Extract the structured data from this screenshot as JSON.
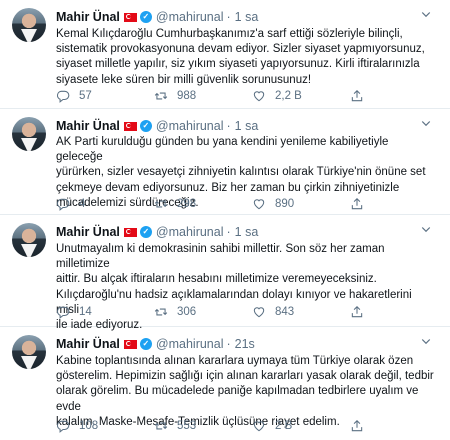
{
  "tweets": [
    {
      "name": "Mahir Ünal",
      "handle": "@mahirunal",
      "dot": "·",
      "time": "1 sa",
      "text": "Kemal Kılıçdaroğlu Cumhurbaşkanımız'a sarf ettiği  sözleriyle bilinçli,\nsistematik provokasyonuna devam ediyor. Sizler siyaset yapmıyorsunuz,\nsiyaset milletle yapılır, siz yıkım siyaseti yapıyorsunuz. Kirli iftiralarınızla\nsiyasete leke süren bir milli güvenlik sorunusunuz!",
      "replies": "57",
      "retweets": "988",
      "likes": "2,2 B"
    },
    {
      "name": "Mahir Ünal",
      "handle": "@mahirunal",
      "dot": "·",
      "time": "1 sa",
      "text": "AK Parti kurulduğu günden bu yana kendini yenileme kabiliyetiyle geleceğe\nyürürken, sizler vesayetçi zihniyetin kalıntısı olarak Türkiye'nin önüne set\nçekmeye devam ediyorsunuz. Biz her zaman bu çirkin zihniyetinizle\nmücadelemizi sürdüreceğiz.",
      "replies": "4",
      "retweets": "298",
      "likes": "890"
    },
    {
      "name": "Mahir Ünal",
      "handle": "@mahirunal",
      "dot": "·",
      "time": "1 sa",
      "text": "Unutmayalım ki demokrasinin sahibi millettir. Son söz her zaman milletimize\naittir. Bu alçak iftiraların hesabını milletimize veremeyeceksiniz.\nKılıçdaroğlu'nu hadsiz açıklamalarından dolayı kınıyor ve hakaretlerini misli\nile iade ediyoruz.",
      "replies": "14",
      "retweets": "306",
      "likes": "843"
    },
    {
      "name": "Mahir Ünal",
      "handle": "@mahirunal",
      "dot": "·",
      "time": "21s",
      "text": "Kabine toplantısında alınan kararlara uymaya tüm Türkiye olarak özen\ngösterelim. Hepimizin sağlığı için alınan kararları yasak olarak değil, tedbir\nolarak görelim. Bu mücadelede paniğe kapılmadan tedbirlere uyalım ve evde\nkalalım. Maske-Mesafe-Temizlik üçlüsüne riayet edelim.",
      "replies": "108",
      "retweets": "553",
      "likes": "2 B"
    }
  ],
  "icons": {
    "reply": "reply-icon",
    "retweet": "retweet-icon",
    "like": "like-icon",
    "share": "share-icon",
    "verified": "verified-badge-icon",
    "flag": "turkey-flag-icon",
    "caret": "chevron-down-icon"
  },
  "colors": {
    "verified": "#1da1f2",
    "secondary_text": "#5b7083",
    "divider": "#e6ecf0",
    "flag": "#e30a17"
  }
}
